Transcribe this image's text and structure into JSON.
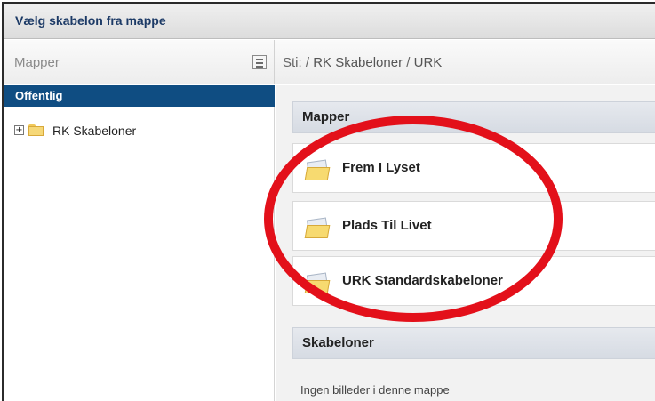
{
  "window": {
    "title": "Vælg skabelon fra mappe"
  },
  "toolbar": {
    "mapper_label": "Mapper",
    "path_prefix": "Sti: / ",
    "path_items": [
      "RK Skabeloner",
      "URK"
    ],
    "path_separator": " / "
  },
  "left_pane": {
    "header": "Offentlig",
    "tree": [
      {
        "expander": "+",
        "label": "RK Skabeloner"
      }
    ]
  },
  "right_pane": {
    "folders_header": "Mapper",
    "folders": [
      {
        "label": "Frem I Lyset"
      },
      {
        "label": "Plads Til Livet"
      },
      {
        "label": "URK Standardskabeloner"
      }
    ],
    "templates_header": "Skabeloner",
    "templates_empty": "Ingen billeder i denne mappe"
  },
  "annotation": {
    "color": "#e3101a"
  }
}
